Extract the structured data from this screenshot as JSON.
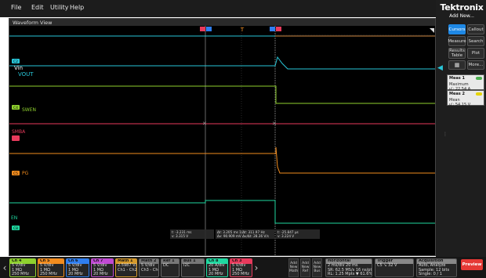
{
  "menu": [
    "File",
    "Edit",
    "Utility",
    "Help"
  ],
  "brand": "Tektronix",
  "add_new": "Add New...",
  "right_panel": {
    "buttons": [
      "Cursors",
      "Callout",
      "Measure",
      "Search",
      "Results Table",
      "Plot",
      "More..."
    ],
    "measurements": [
      {
        "title": "Meas 1",
        "name": "Maximum",
        "value": "μ': 22.54 A",
        "badge_color": "#4caf50"
      },
      {
        "title": "Meas 2",
        "name": "Mean",
        "value": "μ': 54.15 V",
        "badge_color": "#e6d400"
      }
    ]
  },
  "waveform": {
    "title": "Waveform View",
    "labels": [
      {
        "text": "Vin",
        "color": "#ffffff"
      },
      {
        "text": "VOUT",
        "color": "#29c6d8"
      },
      {
        "text": "SWEN",
        "color": "#8fd12e"
      },
      {
        "text": "SMBA",
        "color": "#e83a5c"
      },
      {
        "text": "PG",
        "color": "#f28c1e"
      },
      {
        "text": "EN",
        "color": "#1fd8a0"
      }
    ],
    "channel_markers": [
      "C2",
      "C4",
      "C5",
      "C3",
      "C8"
    ],
    "cursor_readouts": [
      {
        "lines": [
          "t: -3.231 ms",
          "v: 3.315 V"
        ]
      },
      {
        "lines": [
          "Δt: 3.205 ms   1/Δt: 311.97 Hz",
          "Δv: 90.909 mV   Δv/Δt: 28.36 V/s"
        ]
      },
      {
        "lines": [
          "t: -25.847 μs",
          "v: 3.224 V"
        ]
      }
    ]
  },
  "bottom": {
    "channels": [
      {
        "name": "Ch 4",
        "color": "#8fd12e",
        "lines": [
          "5 V/div",
          "1 MΩ",
          "250 MHz"
        ]
      },
      {
        "name": "Ch 5",
        "color": "#f28c1e",
        "lines": [
          "5 V/div",
          "1 MΩ",
          "250 MHz"
        ]
      },
      {
        "name": "Ch 6",
        "color": "#2f7ef0",
        "lines": [
          "5 V/div",
          "1 MΩ",
          "20 MHz"
        ]
      },
      {
        "name": "Ch 7",
        "color": "#c04ad3",
        "lines": [
          "5 V/div",
          "1 MΩ",
          "20 MHz"
        ]
      },
      {
        "name": "Math 1",
        "color": "#d69a2a",
        "lines": [
          "2.5987 V/div",
          "Ch1 - Ch2"
        ]
      },
      {
        "name": "Math 2",
        "color": "#777777",
        "lines": [
          "5 V/div",
          "Ch3 - Ch4"
        ]
      },
      {
        "name": "Ref 1",
        "color": "#777777",
        "lines": [
          "DC"
        ]
      },
      {
        "name": "Bus 1",
        "color": "#777777",
        "lines": [
          "I2C"
        ]
      },
      {
        "name": "Ch 8",
        "color": "#1fd8a0",
        "lines": [
          "20 A/div",
          "1 MΩ",
          "20 MHz"
        ]
      },
      {
        "name": "Ch 3",
        "color": "#e83a5c",
        "lines": [
          "5 V/div",
          "1 MΩ",
          "250 MHz"
        ]
      }
    ],
    "add_buttons": [
      "Add New Math",
      "Add New Ref",
      "Add New Bus"
    ],
    "horizontal": {
      "title": "Horizontal",
      "lines": [
        "2 ms/div   20 ms",
        "SR: 62.5 MS/s   16 ns/pt",
        "RL: 1.25 Mpts   ▼ 61.6%"
      ]
    },
    "trigger": {
      "title": "Trigger",
      "lines": [
        "C5  ↘  32 V"
      ]
    },
    "acquisition": {
      "title": "Acquisition",
      "lines": [
        "Auto,   Analyze",
        "Sample: 12 bits",
        "Single: 0 / 1"
      ]
    },
    "preview": "Preview"
  },
  "colors": {
    "vout": "#29c6d8",
    "swen": "#8fd12e",
    "smba": "#e83a5c",
    "pg": "#f28c1e",
    "en": "#1fd8a0",
    "brown": "#8a5a2b"
  }
}
